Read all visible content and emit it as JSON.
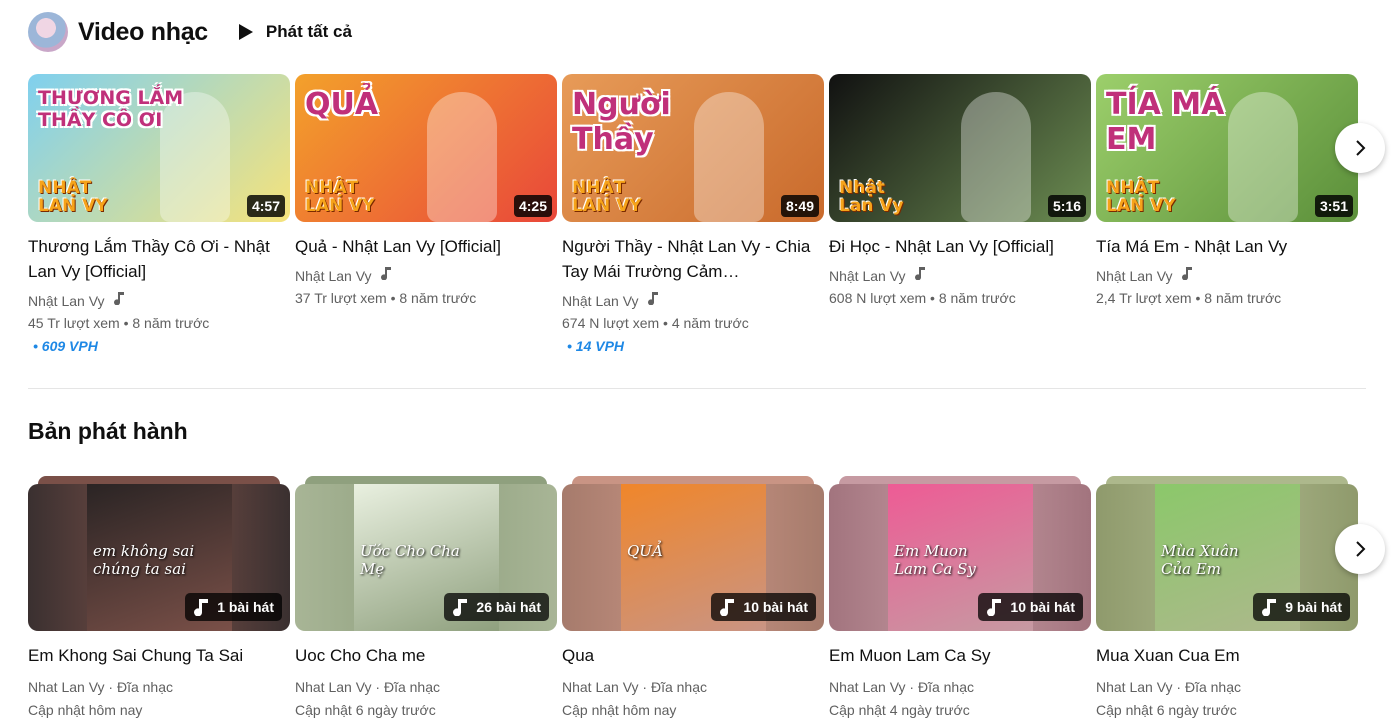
{
  "shelf": {
    "title": "Video nhạc",
    "play_all": "Phát tất cả"
  },
  "videos": [
    {
      "title": "Thương Lắm Thầy Cô Ơi - Nhật Lan Vy [Official]",
      "channel": "Nhật Lan Vy",
      "views": "45 Tr lượt xem",
      "age": "8 năm trước",
      "duration": "4:57",
      "vph": "• 609 VPH",
      "thumb_text": "THƯƠNG LẮM THẦY CÔ ƠI",
      "thumb_badge": "NHẬT LAN VY",
      "colors": [
        "#7fd0ef",
        "#f6e37b"
      ]
    },
    {
      "title": "Quả - Nhật Lan Vy [Official]",
      "channel": "Nhật Lan Vy",
      "views": "37 Tr lượt xem",
      "age": "8 năm trước",
      "duration": "4:25",
      "vph": "",
      "thumb_text": "QUẢ",
      "thumb_badge": "NHẬT LAN VY",
      "colors": [
        "#f3a12b",
        "#e9473a"
      ]
    },
    {
      "title": "Người Thầy - Nhật Lan Vy - Chia Tay Mái Trường Cảm…",
      "channel": "Nhật Lan Vy",
      "views": "674 N lượt xem",
      "age": "4 năm trước",
      "duration": "8:49",
      "vph": "• 14 VPH",
      "thumb_text": "Người Thầy",
      "thumb_badge": "NHẬT LAN VY",
      "colors": [
        "#e79b58",
        "#c96a2c"
      ]
    },
    {
      "title": "Đi Học - Nhật Lan Vy [Official]",
      "channel": "Nhật Lan Vy",
      "views": "608 N lượt xem",
      "age": "8 năm trước",
      "duration": "5:16",
      "vph": "",
      "thumb_text": "",
      "thumb_badge": "Nhật Lan Vy",
      "colors": [
        "#111111",
        "#6c8d52"
      ]
    },
    {
      "title": "Tía Má Em - Nhật Lan Vy",
      "channel": "Nhật Lan Vy",
      "views": "2,4 Tr lượt xem",
      "age": "8 năm trước",
      "duration": "3:51",
      "vph": "",
      "thumb_text": "TÍA MÁ EM",
      "thumb_badge": "NHẬT LAN VY",
      "colors": [
        "#9ccf6b",
        "#5b8f3a"
      ]
    }
  ],
  "releases": {
    "title": "Bản phát hành",
    "items": [
      {
        "title": "Em Khong Sai Chung Ta Sai",
        "meta": "Nhat Lan Vy · Đĩa nhạc",
        "updated": "Cập nhật hôm nay",
        "songs": "1 bài hát",
        "cover_text": "em không sai chúng ta sai",
        "colors": [
          "#3a3030",
          "#7a5048",
          "#2a2424"
        ]
      },
      {
        "title": "Uoc Cho Cha me",
        "meta": "Nhat Lan Vy · Đĩa nhạc",
        "updated": "Cập nhật 6 ngày trước",
        "songs": "26 bài hát",
        "cover_text": "Ước Cho Cha Mẹ",
        "colors": [
          "#a8b596",
          "#8fa07e",
          "#e9f0e0"
        ]
      },
      {
        "title": "Qua",
        "meta": "Nhat Lan Vy · Đĩa nhạc",
        "updated": "Cập nhật hôm nay",
        "songs": "10 bài hát",
        "cover_text": "QUẢ",
        "colors": [
          "#a67b6c",
          "#c99484",
          "#f0862a"
        ]
      },
      {
        "title": "Em Muon Lam Ca Sy",
        "meta": "Nhat Lan Vy · Đĩa nhạc",
        "updated": "Cập nhật 4 ngày trước",
        "songs": "10 bài hát",
        "cover_text": "Em Muon Lam Ca Sy",
        "colors": [
          "#a2747e",
          "#c69aa2",
          "#ee5b95"
        ]
      },
      {
        "title": "Mua Xuan Cua Em",
        "meta": "Nhat Lan Vy · Đĩa nhạc",
        "updated": "Cập nhật 6 ngày trước",
        "songs": "9 bài hát",
        "cover_text": "Mùa Xuân Của Em",
        "colors": [
          "#8f9a6c",
          "#adb88c",
          "#8bc86a"
        ]
      }
    ]
  },
  "icons": {
    "play": "play-icon",
    "next": "chevron-right-icon",
    "music": "music-note-icon",
    "playlist": "playlist-music-icon"
  }
}
